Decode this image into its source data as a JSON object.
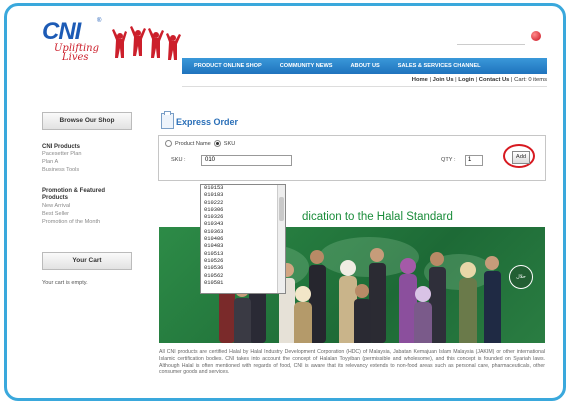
{
  "header": {
    "logo_text": "CNI",
    "logo_tagline_1": "Uplifting",
    "logo_tagline_2": "Lives"
  },
  "nav": {
    "items": [
      "PRODUCT ONLINE SHOP",
      "COMMUNITY NEWS",
      "ABOUT US",
      "SALES & SERVICES CHANNEL"
    ]
  },
  "subnav": {
    "home": "Home",
    "join": "Join Us",
    "login": "Login",
    "contact": "Contact Us",
    "cart": "Cart: 0 items"
  },
  "sidebar": {
    "browse_label": "Browse Our Shop",
    "cni_products_title": "CNI Products",
    "cni_products": [
      "Pacesetter Plan",
      "Plan A",
      "Business Tools"
    ],
    "promo_title_1": "Promotion & Featured",
    "promo_title_2": "Products",
    "promo_items": [
      "New Arrival",
      "Best Seller",
      "Promotion of the Month"
    ],
    "cart_label": "Your Cart",
    "cart_empty": "Your cart is empty."
  },
  "express_order": {
    "title": "Express Order",
    "radio_product_name": "Product Name",
    "radio_sku": "SKU",
    "sku_label": "SKU :",
    "sku_value": "010",
    "qty_label": "QTY :",
    "qty_value": "1",
    "add_label": "Add",
    "dropdown_options": [
      "010153",
      "010183",
      "010222",
      "010306",
      "010326",
      "010343",
      "010363",
      "010406",
      "010483",
      "010513",
      "010526",
      "010536",
      "010562",
      "010581"
    ]
  },
  "content": {
    "halal_title": "dication to the Halal Standard",
    "paragraph": "All CNI products are certified Halal by Halal Industry Development Corporation (HDC) of Malaysia, Jabatan Kemajuan Islam Malaysia (JAKIM) or other international Islamic certification bodies. CNI takes into account the concept of Halalan Toyyiban (permissible and wholesome), and this concept is founded on Syariah laws. Although Halal is often mentioned with regards of food, CNI is aware that its relevancy extends to non-food areas such as personal care, pharmaceuticals, other consumer goods and services."
  },
  "colors": {
    "frame": "#3aa8dc",
    "nav_bg": "#1f73bd",
    "brand_blue": "#1d5bb5",
    "brand_red": "#cc1f2b",
    "title_blue": "#2a6fb8",
    "highlight_red": "#d71920",
    "halal_green": "#1a8c3a"
  }
}
